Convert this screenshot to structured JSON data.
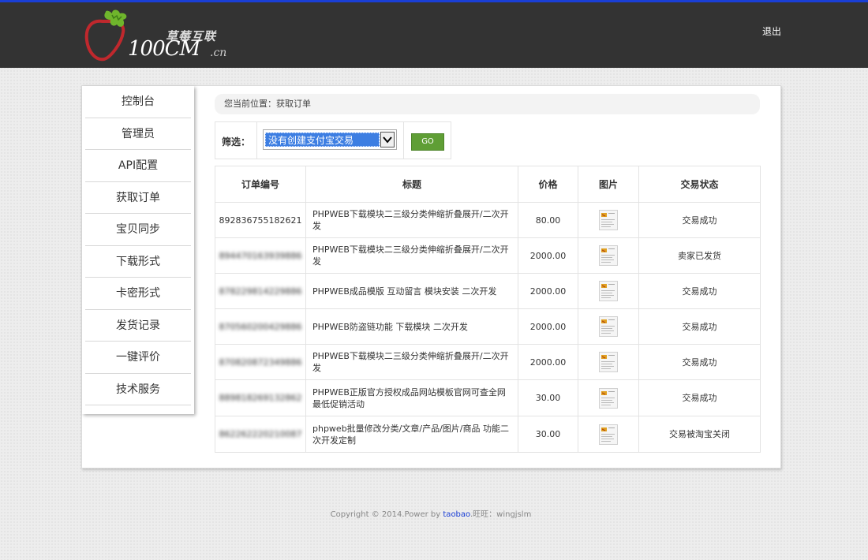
{
  "header": {
    "logo_cn": "草莓互联",
    "logo_en": "100CM",
    "logo_suffix": ".cn",
    "logout_label": "退出"
  },
  "sidebar": {
    "items": [
      {
        "label": "控制台"
      },
      {
        "label": "管理员"
      },
      {
        "label": "API配置"
      },
      {
        "label": "获取订单"
      },
      {
        "label": "宝贝同步"
      },
      {
        "label": "下载形式"
      },
      {
        "label": "卡密形式"
      },
      {
        "label": "发货记录"
      },
      {
        "label": "一键评价"
      },
      {
        "label": "技术服务"
      }
    ]
  },
  "breadcrumb": "您当前位置：获取订单",
  "filter": {
    "label": "筛选：",
    "selected": "没有创建支付宝交易",
    "go_label": "GO"
  },
  "table": {
    "headers": [
      "订单编号",
      "标题",
      "价格",
      "图片",
      "交易状态"
    ],
    "rows": [
      {
        "id": "892836755182621",
        "title": "PHPWEB下载模块二三级分类伸缩折叠展开/二次开发",
        "price": "80.00",
        "status": "交易成功"
      },
      {
        "id": "894470163939886",
        "title": "PHPWEB下载模块二三级分类伸缩折叠展开/二次开发",
        "price": "2000.00",
        "status": "卖家已发货"
      },
      {
        "id": "878229814229886",
        "title": "PHPWEB成品模版 互动留言 模块安装 二次开发",
        "price": "2000.00",
        "status": "交易成功"
      },
      {
        "id": "870560200429886",
        "title": "PHPWEB防盗链功能 下载模块 二次开发",
        "price": "2000.00",
        "status": "交易成功"
      },
      {
        "id": "870820872349886",
        "title": "PHPWEB下载模块二三级分类伸缩折叠展开/二次开发",
        "price": "2000.00",
        "status": "交易成功"
      },
      {
        "id": "889818269132862",
        "title": "PHPWEB正版官方授权成品网站模板官网可查全网最低促销活动",
        "price": "30.00",
        "status": "交易成功"
      },
      {
        "id": "862262220210087",
        "title": "phpweb批量修改分类/文章/产品/图片/商品 功能二次开发定制",
        "price": "30.00",
        "status": "交易被淘宝关闭"
      }
    ]
  },
  "footer": {
    "prefix": "Copyright © 2014.Power by ",
    "link": "taobao",
    "suffix": ".旺旺：wingjslm"
  },
  "colors": {
    "header_bg": "#333333",
    "top_accent": "#1a3fd6",
    "go_button": "#5f9e35",
    "select_highlight": "#3d7ee2"
  }
}
